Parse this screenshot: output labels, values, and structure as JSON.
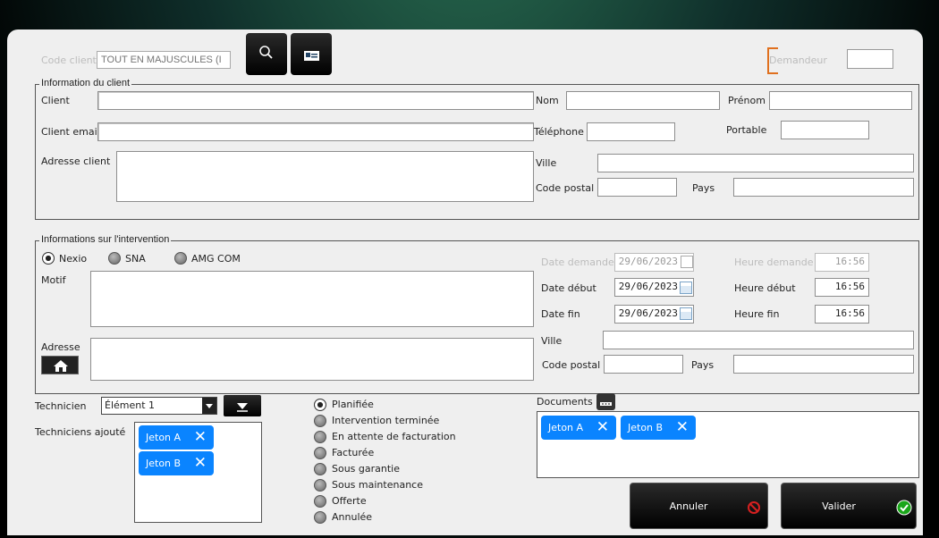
{
  "top": {
    "code_client_label": "Code client",
    "code_client_placeholder": "TOUT EN MAJUSCULES (I",
    "demandeur_label": "Demandeur"
  },
  "client_group": {
    "title": "Information du client",
    "client_label": "Client",
    "email_label": "Client email",
    "adresse_label": "Adresse client",
    "nom_label": "Nom",
    "prenom_label": "Prénom",
    "telephone_label": "Téléphone",
    "portable_label": "Portable",
    "ville_label": "Ville",
    "code_postal_label": "Code postal",
    "pays_label": "Pays"
  },
  "intervention_group": {
    "title": "Informations sur l'intervention",
    "radios": [
      {
        "label": "Nexio",
        "selected": true
      },
      {
        "label": "SNA",
        "selected": false
      },
      {
        "label": "AMG COM",
        "selected": false
      }
    ],
    "motif_label": "Motif",
    "adresse_label": "Adresse",
    "date_demande_label": "Date demande",
    "date_demande": "29/06/2023",
    "heure_demande_label": "Heure demande",
    "heure_demande": "16:56",
    "date_debut_label": "Date début",
    "date_debut": "29/06/2023",
    "heure_debut_label": "Heure début",
    "heure_debut": "16:56",
    "date_fin_label": "Date fin",
    "date_fin": "29/06/2023",
    "heure_fin_label": "Heure fin",
    "heure_fin": "16:56",
    "ville_label": "Ville",
    "code_postal_label": "Code postal",
    "pays_label": "Pays"
  },
  "techniciens": {
    "label": "Technicien",
    "selected": "Élément 1",
    "added_label": "Techniciens ajouté",
    "chips": [
      "Jeton A",
      "Jeton B"
    ]
  },
  "statuts": [
    {
      "label": "Planifiée",
      "selected": true
    },
    {
      "label": "Intervention terminée",
      "selected": false
    },
    {
      "label": "En attente de facturation",
      "selected": false
    },
    {
      "label": "Facturée",
      "selected": false
    },
    {
      "label": "Sous garantie",
      "selected": false
    },
    {
      "label": "Sous maintenance",
      "selected": false
    },
    {
      "label": "Offerte",
      "selected": false
    },
    {
      "label": "Annulée",
      "selected": false
    }
  ],
  "documents": {
    "label": "Documents",
    "chips": [
      "Jeton A",
      "Jeton B"
    ]
  },
  "buttons": {
    "annuler": "Annuler",
    "valider": "Valider"
  },
  "colors": {
    "chip": "#0a84ff",
    "valider_icon": "#1aa61a",
    "annuler_icon": "#d62020"
  }
}
